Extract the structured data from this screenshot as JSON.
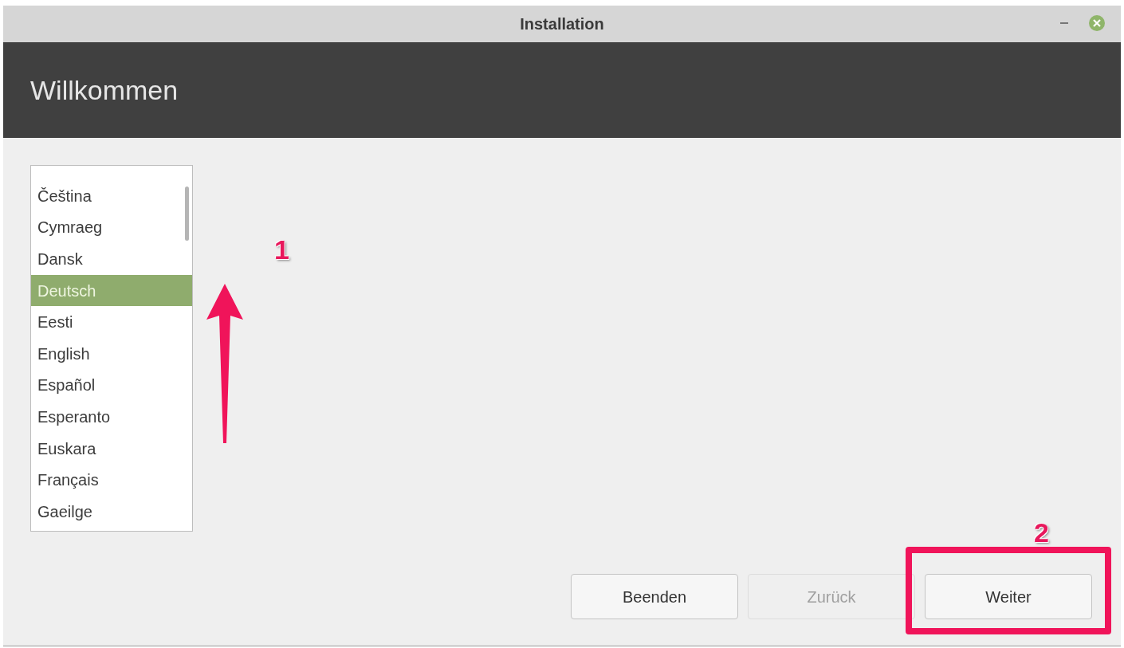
{
  "window": {
    "title": "Installation"
  },
  "header": {
    "title": "Willkommen"
  },
  "languages": [
    {
      "label": "Čeština",
      "selected": false
    },
    {
      "label": "Cymraeg",
      "selected": false
    },
    {
      "label": "Dansk",
      "selected": false
    },
    {
      "label": "Deutsch",
      "selected": true
    },
    {
      "label": "Eesti",
      "selected": false
    },
    {
      "label": "English",
      "selected": false
    },
    {
      "label": "Español",
      "selected": false
    },
    {
      "label": "Esperanto",
      "selected": false
    },
    {
      "label": "Euskara",
      "selected": false
    },
    {
      "label": "Français",
      "selected": false
    },
    {
      "label": "Gaeilge",
      "selected": false
    }
  ],
  "buttons": [
    {
      "label": "Beenden",
      "disabled": false
    },
    {
      "label": "Zurück",
      "disabled": true
    },
    {
      "label": "Weiter",
      "disabled": false
    }
  ],
  "annotations": [
    {
      "label": "1"
    },
    {
      "label": "2"
    }
  ]
}
